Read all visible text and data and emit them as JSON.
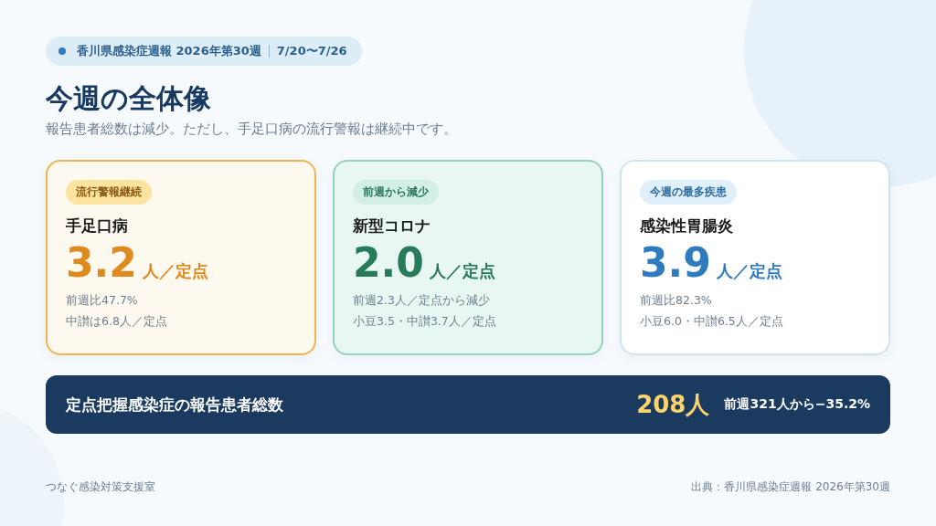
{
  "header": {
    "report": "香川県感染症週報 2026年第30週",
    "period": "7/20〜7/26"
  },
  "title": "今週の全体像",
  "subtitle": "報告患者総数は減少。ただし、手足口病の流行警報は継続中です。",
  "cards": [
    {
      "kind": "alert",
      "badge": "流行警報継続",
      "disease": "手足口病",
      "value": "3.2",
      "unit": "人／定点",
      "notes": [
        "前週比47.7%",
        "中讃は6.8人／定点"
      ]
    },
    {
      "kind": "decrease",
      "badge": "前週から減少",
      "disease": "新型コロナ",
      "value": "2.0",
      "unit": "人／定点",
      "notes": [
        "前週2.3人／定点から減少",
        "小豆3.5・中讃3.7人／定点"
      ]
    },
    {
      "kind": "top",
      "badge": "今週の最多疾患",
      "disease": "感染性胃腸炎",
      "value": "3.9",
      "unit": "人／定点",
      "notes": [
        "前週比82.3%",
        "小豆6.0・中讃6.5人／定点"
      ]
    }
  ],
  "total": {
    "label": "定点把握感染症の報告患者総数",
    "value": "208人",
    "change": "前週321人から−35.2%"
  },
  "footer": {
    "left": "つなぐ感染対策支援室",
    "right": "出典：香川県感染症週報 2026年第30週"
  }
}
